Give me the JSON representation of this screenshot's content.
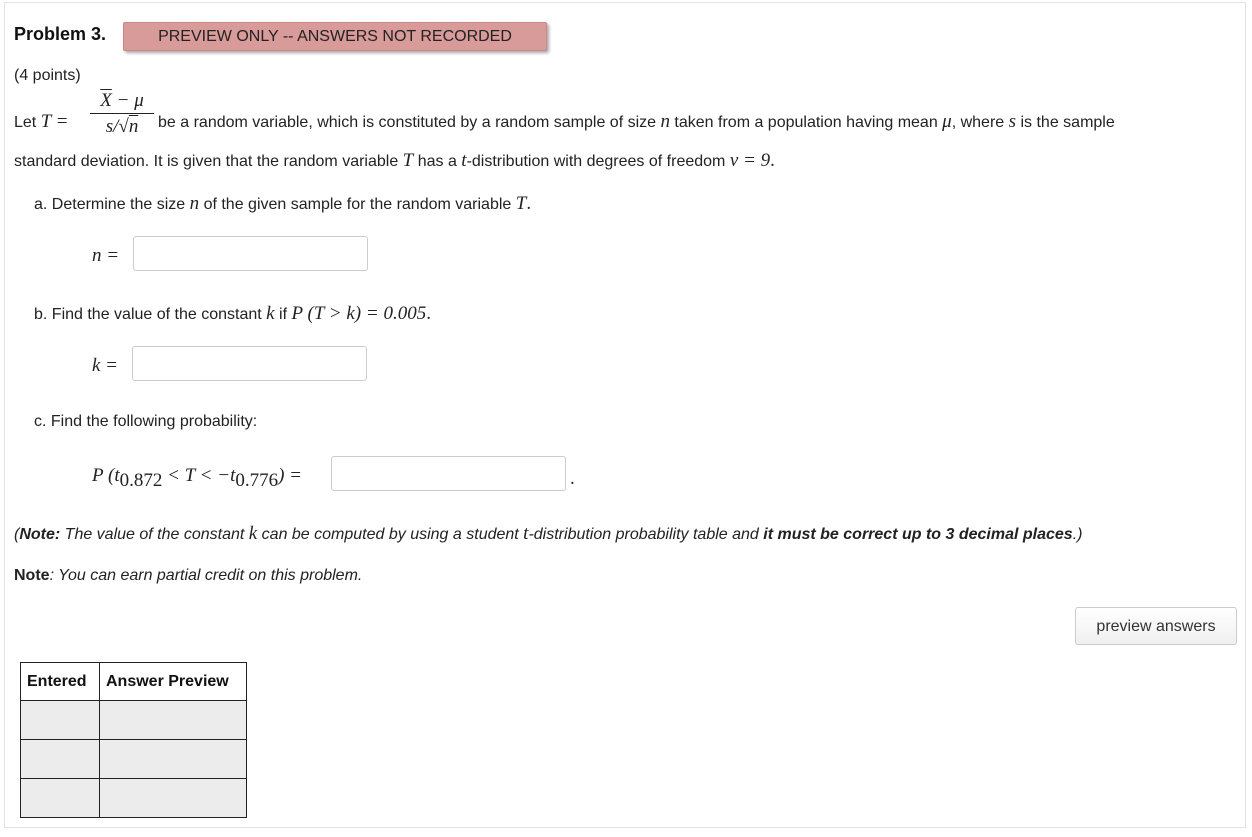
{
  "problem": {
    "title": "Problem 3.",
    "badge": "PREVIEW ONLY -- ANSWERS NOT RECORDED",
    "points": "(4 points)"
  },
  "statement": {
    "let_prefix": "Let",
    "T_eq": "T =",
    "frac_num_X": "X",
    "frac_num_rest": " − μ",
    "frac_den_s": "s/",
    "frac_den_root": "√",
    "frac_den_n": "n",
    "line1_part1": " be a random variable, which is constituted by a random sample of size ",
    "n": "n",
    "line1_part2": " taken from a population having mean ",
    "mu": "μ",
    "line1_part3": ", where ",
    "s": "s",
    "line1_part4": " is the sample",
    "line2_part1": "standard deviation. It is given that the random variable ",
    "T": "T",
    "line2_part2": " has a ",
    "t": "t",
    "line2_part3": "-distribution with degrees of freedom ",
    "nu_eq": "ν = 9",
    "line2_end": "."
  },
  "part_a": {
    "text": "a. Determine the size ",
    "n": "n",
    "text2": " of the given sample for the random variable ",
    "T": "T",
    "end": ".",
    "label": "n =",
    "value": ""
  },
  "part_b": {
    "text": "b. Find the value of the constant ",
    "k": "k",
    "text2": " if ",
    "expr": "P (T > k) = 0.005",
    "end": ".",
    "label": "k =",
    "value": ""
  },
  "part_c": {
    "text": "c. Find the following probability:",
    "P_open": "P (t",
    "sub1": "0.872",
    "mid": " < T < −t",
    "sub2": "0.776",
    "close": ") =",
    "end": ".",
    "value": ""
  },
  "notes": {
    "note1_open": "(",
    "note1_bold": "Note:",
    "note1_text": " The value of the constant ",
    "note1_k": "k",
    "note1_text2": " can be computed by using a student ",
    "note1_t": "t",
    "note1_text3": "-distribution probability table and ",
    "note1_bold2": "it must be correct up to 3 decimal places",
    "note1_close": ".)",
    "note2_bold": "Note",
    "note2_text": ": You can earn partial credit on this problem."
  },
  "preview_button": "preview answers",
  "answers_table": {
    "headers": [
      "Entered",
      "Answer Preview"
    ],
    "rows": [
      [
        "",
        ""
      ],
      [
        "",
        ""
      ],
      [
        "",
        ""
      ]
    ]
  }
}
